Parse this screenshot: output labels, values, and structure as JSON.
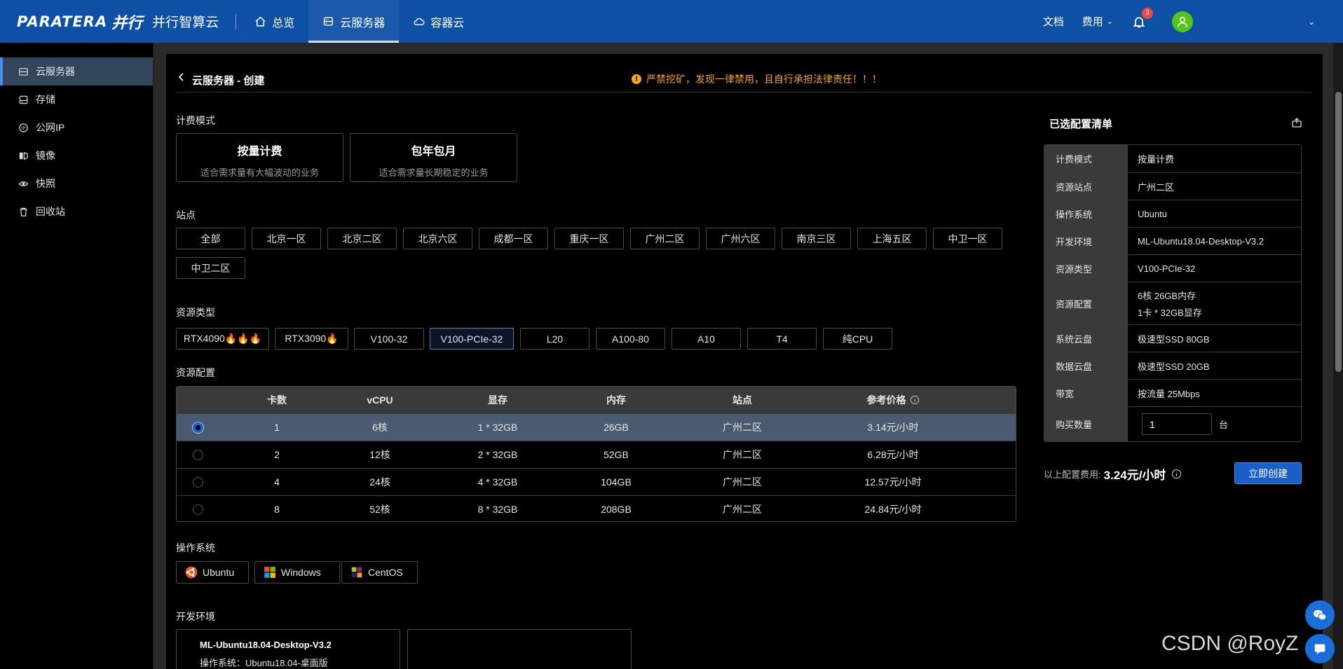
{
  "topbar": {
    "brand": "PARATERA",
    "brand_cn": "并行",
    "product": "并行智算云",
    "nav": [
      {
        "label": "总览",
        "icon": "home-icon"
      },
      {
        "label": "云服务器",
        "icon": "server-icon",
        "active": true
      },
      {
        "label": "容器云",
        "icon": "cloud-icon"
      }
    ],
    "docs": "文档",
    "fees": "费用",
    "notification_count": "3",
    "username": "    "
  },
  "sidebar": {
    "items": [
      {
        "label": "云服务器",
        "icon": "server-icon"
      },
      {
        "label": "存储",
        "icon": "storage-icon"
      },
      {
        "label": "公网IP",
        "icon": "ip-icon"
      },
      {
        "label": "镜像",
        "icon": "image-icon"
      },
      {
        "label": "快照",
        "icon": "snapshot-icon"
      },
      {
        "label": "回收站",
        "icon": "recycle-icon"
      }
    ]
  },
  "header": {
    "title": "云服务器 - 创建",
    "warning": "严禁挖矿，发现一律禁用，且自行承担法律责任！！！"
  },
  "billing": {
    "label": "计费模式",
    "options": [
      {
        "title": "按量计费",
        "desc": "适合需求量有大幅波动的业务"
      },
      {
        "title": "包年包月",
        "desc": "适合需求量长期稳定的业务"
      }
    ]
  },
  "site": {
    "label": "站点",
    "options": [
      "全部",
      "北京一区",
      "北京二区",
      "北京六区",
      "成都一区",
      "重庆一区",
      "广州二区",
      "广州六区",
      "南京三区",
      "上海五区",
      "中卫一区",
      "中卫二区"
    ]
  },
  "resource_type": {
    "label": "资源类型",
    "options": [
      "RTX4090🔥🔥🔥",
      "RTX3090🔥",
      "V100-32",
      "V100-PCIe-32",
      "L20",
      "A100-80",
      "A10",
      "T4",
      "纯CPU"
    ]
  },
  "resource_config": {
    "label": "资源配置",
    "columns": [
      "卡数",
      "vCPU",
      "显存",
      "内存",
      "站点",
      "参考价格"
    ],
    "rows": [
      [
        "1",
        "6核",
        "1 * 32GB",
        "26GB",
        "广州二区",
        "3.14元/小时"
      ],
      [
        "2",
        "12核",
        "2 * 32GB",
        "52GB",
        "广州二区",
        "6.28元/小时"
      ],
      [
        "4",
        "24核",
        "4 * 32GB",
        "104GB",
        "广州二区",
        "12.57元/小时"
      ],
      [
        "8",
        "52核",
        "8 * 32GB",
        "208GB",
        "广州二区",
        "24.84元/小时"
      ]
    ]
  },
  "os": {
    "label": "操作系统",
    "options": [
      {
        "label": "Ubuntu",
        "icon": "ubuntu-icon"
      },
      {
        "label": "Windows",
        "icon": "windows-icon"
      },
      {
        "label": "CentOS",
        "icon": "centos-icon"
      }
    ]
  },
  "env": {
    "label": "开发环境",
    "card_title": "ML-Ubuntu18.04-Desktop-V3.2",
    "card_sub": "操作系统：Ubuntu18.04-桌面版"
  },
  "summary": {
    "title": "已选配置清单",
    "rows": [
      {
        "k": "计费模式",
        "v": "按量计费"
      },
      {
        "k": "资源站点",
        "v": "广州二区"
      },
      {
        "k": "操作系统",
        "v": "Ubuntu"
      },
      {
        "k": "开发环境",
        "v": "ML-Ubuntu18.04-Desktop-V3.2"
      },
      {
        "k": "资源类型",
        "v": "V100-PCIe-32"
      },
      {
        "k": "资源配置",
        "v": "6核 26GB内存",
        "v2": "1卡 * 32GB显存"
      },
      {
        "k": "系统云盘",
        "v": "极速型SSD 80GB"
      },
      {
        "k": "数据云盘",
        "v": "极速型SSD 20GB"
      },
      {
        "k": "带宽",
        "v": "按流量 25Mbps"
      }
    ],
    "qty_label": "购买数量",
    "qty_value": "1",
    "qty_unit": "台",
    "price_label": "以上配置费用:",
    "price_value": "3.24元/小时",
    "create_label": "立即创建"
  },
  "watermark": "CSDN @RoyZ",
  "colors": {
    "topbar": "#0d50a6",
    "accent": "#1a5fc8",
    "warning": "#f5a623"
  }
}
